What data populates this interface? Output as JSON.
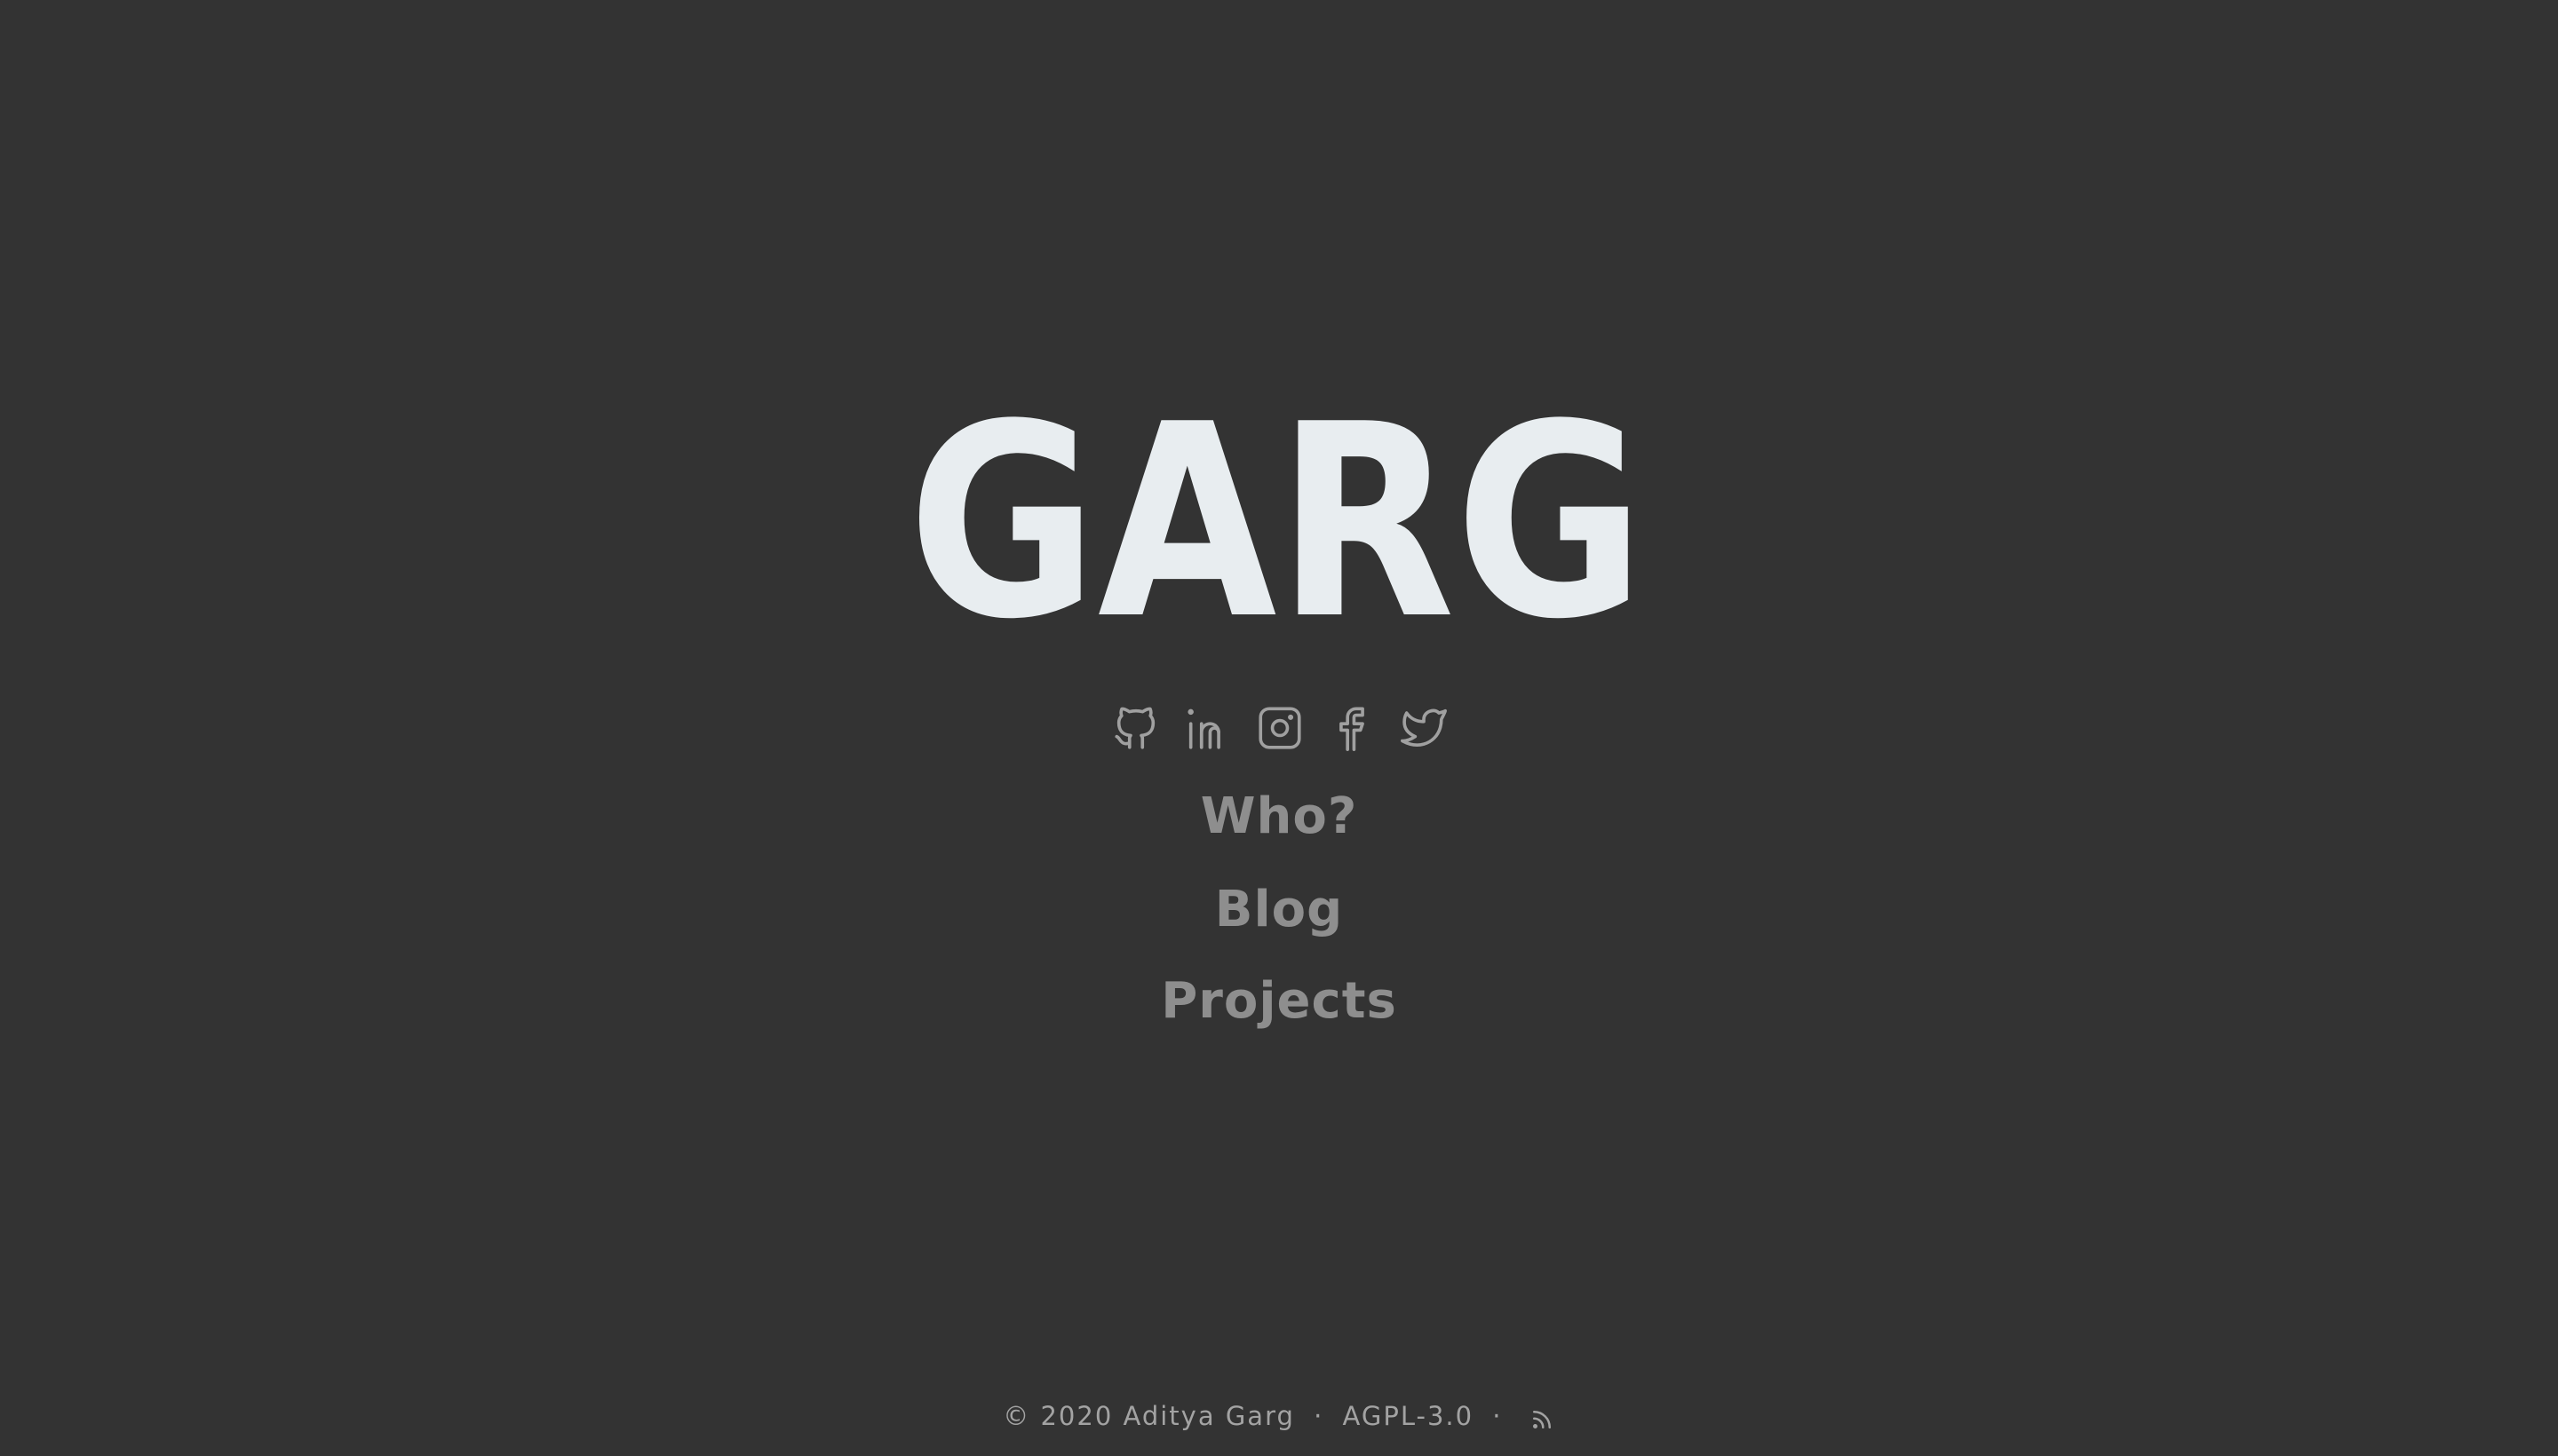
{
  "site": {
    "logo_text": "GARG",
    "logo_color": "#e8edf0",
    "background": "#333333"
  },
  "social": [
    {
      "name": "github",
      "icon": "github-icon"
    },
    {
      "name": "linkedin",
      "icon": "linkedin-icon"
    },
    {
      "name": "instagram",
      "icon": "instagram-icon"
    },
    {
      "name": "facebook",
      "icon": "facebook-icon"
    },
    {
      "name": "twitter",
      "icon": "twitter-icon"
    }
  ],
  "nav": {
    "who": "Who?",
    "blog": "Blog",
    "projects": "Projects",
    "link_color": "#8e8e8e"
  },
  "footer": {
    "copyright": "© 2020 Aditya Garg",
    "separator": "·",
    "license": "AGPL-3.0",
    "rss_icon": "rss-icon"
  }
}
